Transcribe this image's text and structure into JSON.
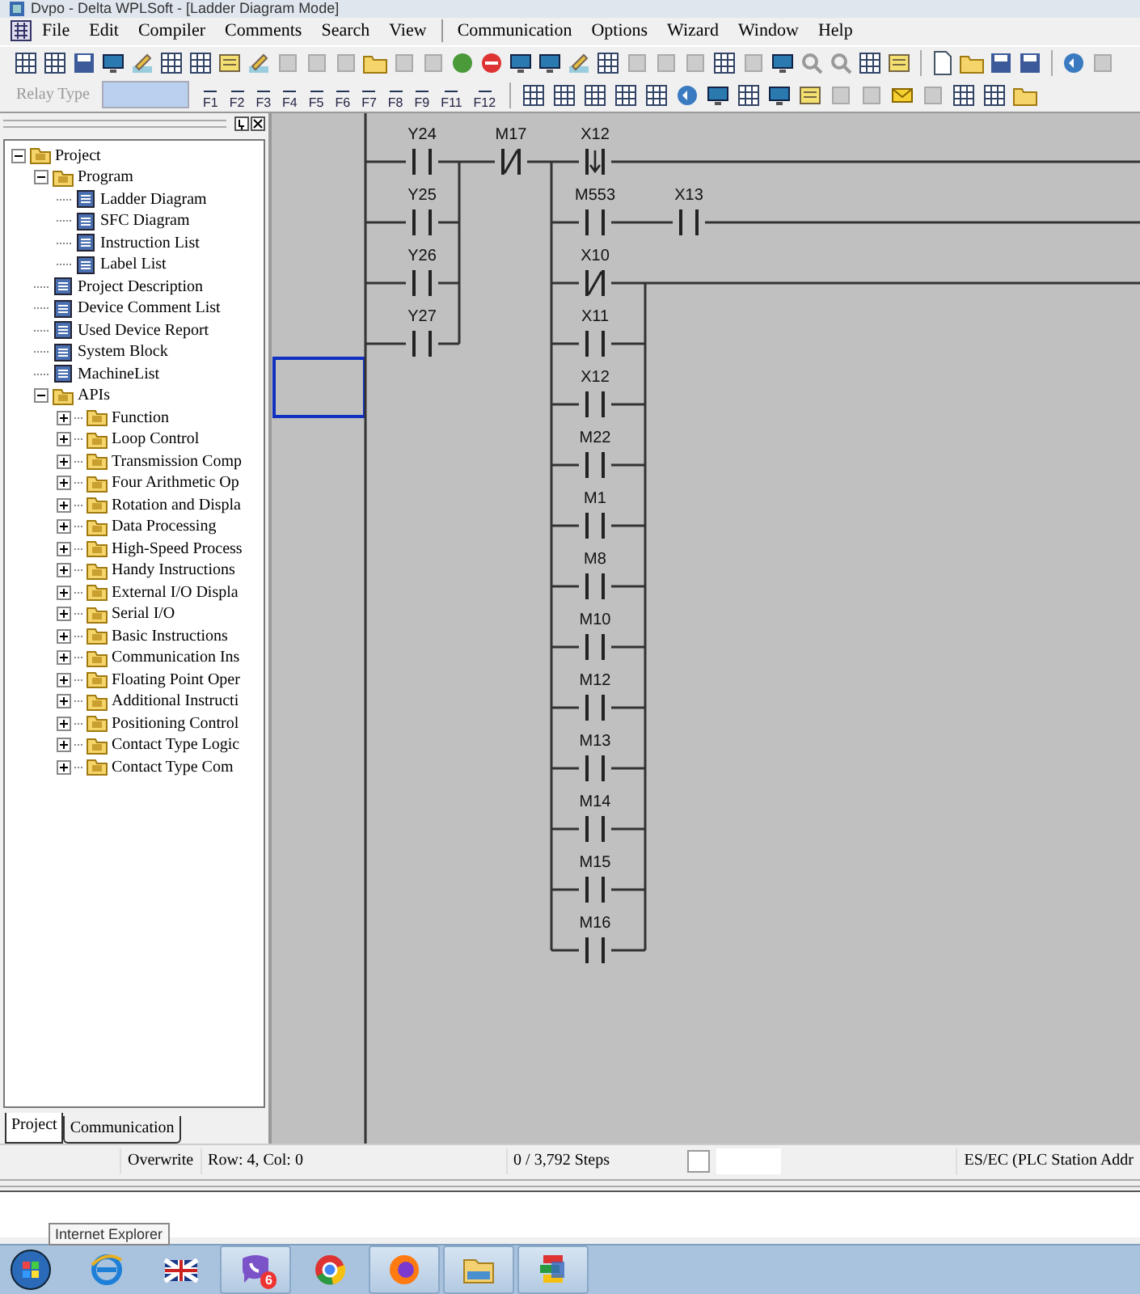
{
  "window": {
    "title": "Dvpo - Delta WPLSoft - [Ladder Diagram Mode]"
  },
  "menu": {
    "left": [
      "File",
      "Edit",
      "Compiler",
      "Comments",
      "Search",
      "View"
    ],
    "right": [
      "Communication",
      "Options",
      "Wizard",
      "Window",
      "Help"
    ]
  },
  "toolbar2": {
    "relay_type": {
      "label": "Relay Type",
      "disabled": true
    },
    "function_keys": [
      "F1",
      "F2",
      "F3",
      "F4",
      "F5",
      "F6",
      "F7",
      "F8",
      "F9",
      "F11",
      "F12"
    ]
  },
  "project_tree": {
    "items": [
      {
        "label": "Project",
        "kind": "folder",
        "expanded": true,
        "children": [
          {
            "label": "Program",
            "kind": "folder",
            "expanded": true,
            "children": [
              {
                "label": "Ladder Diagram",
                "kind": "file"
              },
              {
                "label": "SFC Diagram",
                "kind": "file"
              },
              {
                "label": "Instruction List",
                "kind": "file"
              },
              {
                "label": "Label List",
                "kind": "file"
              }
            ]
          },
          {
            "label": "Project Description",
            "kind": "file"
          },
          {
            "label": "Device Comment List",
            "kind": "file"
          },
          {
            "label": "Used Device Report",
            "kind": "file"
          },
          {
            "label": "System Block",
            "kind": "file"
          },
          {
            "label": "MachineList",
            "kind": "file"
          },
          {
            "label": "APIs",
            "kind": "folder",
            "expanded": true,
            "children": [
              {
                "label": "Function",
                "kind": "folder",
                "expanded": false
              },
              {
                "label": "Loop Control",
                "kind": "folder",
                "expanded": false
              },
              {
                "label": "Transmission Comp",
                "kind": "folder",
                "expanded": false
              },
              {
                "label": "Four Arithmetic Op",
                "kind": "folder",
                "expanded": false
              },
              {
                "label": "Rotation and Displa",
                "kind": "folder",
                "expanded": false
              },
              {
                "label": "Data Processing",
                "kind": "folder",
                "expanded": false
              },
              {
                "label": "High-Speed Process",
                "kind": "folder",
                "expanded": false
              },
              {
                "label": "Handy Instructions",
                "kind": "folder",
                "expanded": false
              },
              {
                "label": "External I/O Displa",
                "kind": "folder",
                "expanded": false
              },
              {
                "label": "Serial I/O",
                "kind": "folder",
                "expanded": false
              },
              {
                "label": "Basic Instructions",
                "kind": "folder",
                "expanded": false
              },
              {
                "label": "Communication Ins",
                "kind": "folder",
                "expanded": false
              },
              {
                "label": "Floating Point Oper",
                "kind": "folder",
                "expanded": false
              },
              {
                "label": "Additional Instructi",
                "kind": "folder",
                "expanded": false
              },
              {
                "label": "Positioning Control",
                "kind": "folder",
                "expanded": false
              },
              {
                "label": "Contact Type Logic",
                "kind": "folder",
                "expanded": false
              },
              {
                "label": "Contact Type Com",
                "kind": "folder",
                "expanded": false
              }
            ]
          }
        ]
      }
    ]
  },
  "panel_tabs": [
    {
      "label": "Project",
      "selected": true
    },
    {
      "label": "Communication",
      "selected": false
    }
  ],
  "ladder": {
    "left_branch": [
      {
        "label": "Y24",
        "kind": "open"
      },
      {
        "label": "Y25",
        "kind": "open"
      },
      {
        "label": "Y26",
        "kind": "open"
      },
      {
        "label": "Y27",
        "kind": "open"
      }
    ],
    "series": [
      {
        "label": "M17",
        "kind": "closed"
      }
    ],
    "right_branch": [
      [
        {
          "label": "X12",
          "kind": "falling"
        }
      ],
      [
        {
          "label": "M553",
          "kind": "open"
        },
        {
          "label": "X13",
          "kind": "open"
        }
      ],
      [
        {
          "label": "X10",
          "kind": "closed"
        }
      ],
      [
        {
          "label": "X11",
          "kind": "open"
        }
      ],
      [
        {
          "label": "X12",
          "kind": "open"
        }
      ],
      [
        {
          "label": "M22",
          "kind": "open"
        }
      ],
      [
        {
          "label": "M1",
          "kind": "open"
        }
      ],
      [
        {
          "label": "M8",
          "kind": "open"
        }
      ],
      [
        {
          "label": "M10",
          "kind": "open"
        }
      ],
      [
        {
          "label": "M12",
          "kind": "open"
        }
      ],
      [
        {
          "label": "M13",
          "kind": "open"
        }
      ],
      [
        {
          "label": "M14",
          "kind": "open"
        }
      ],
      [
        {
          "label": "M15",
          "kind": "open"
        }
      ],
      [
        {
          "label": "M16",
          "kind": "open"
        }
      ]
    ]
  },
  "status_bar": {
    "mode": "Overwrite",
    "position": "Row: 4, Col: 0",
    "steps": "0 / 3,792 Steps",
    "station": "ES/EC (PLC Station Addr"
  },
  "taskbar": {
    "tooltip": "Internet Explorer",
    "apps": [
      {
        "kind": "browser-e",
        "running": false
      },
      {
        "kind": "flag",
        "running": false
      },
      {
        "kind": "chat",
        "running": true,
        "badge": "6"
      },
      {
        "kind": "chrome",
        "running": false
      },
      {
        "kind": "firefox",
        "running": true
      },
      {
        "kind": "folder",
        "running": true
      },
      {
        "kind": "stack",
        "running": true
      }
    ]
  }
}
